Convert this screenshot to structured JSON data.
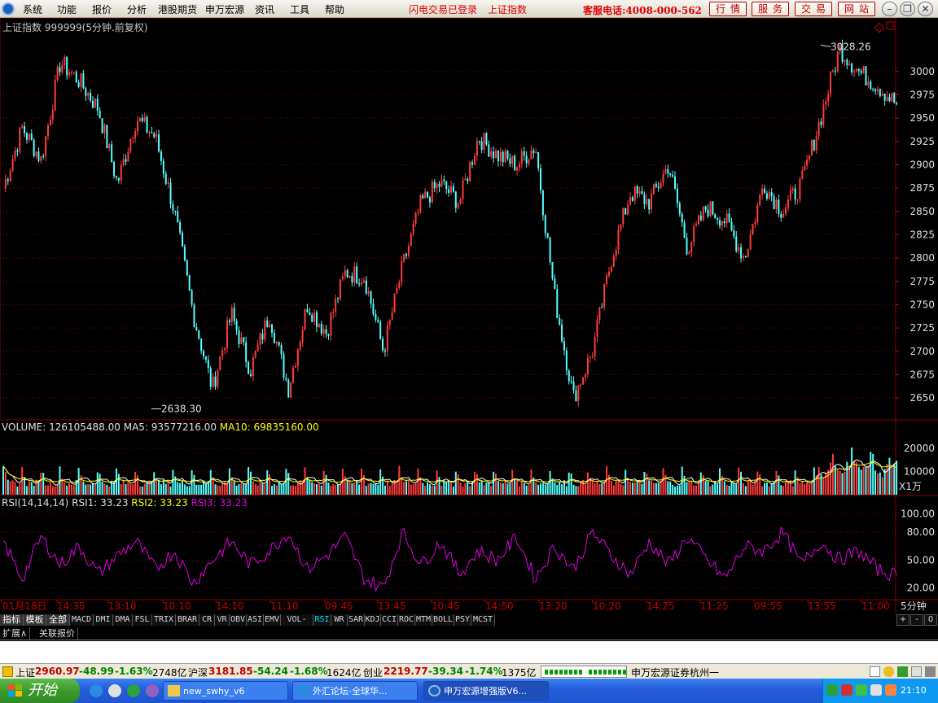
{
  "menu": {
    "items": [
      "系统",
      "功能",
      "报价",
      "分析",
      "港股期货",
      "申万宏源",
      "资讯",
      "工具",
      "帮助"
    ],
    "flash_status": "闪电交易已登录",
    "index_link": "上证指数",
    "hotline": "客服电话:4008-000-562",
    "buttons": [
      "行情",
      "服务",
      "交易",
      "网站"
    ]
  },
  "chart": {
    "main_title": "上证指数 999999(5分钟.前复权)",
    "high_label": "3028.26",
    "low_label": "2638.30",
    "vol_title": {
      "volume": "VOLUME: 126105488.00",
      "ma5": "MA5: 93577216.00",
      "ma10": "MA10: 69835160.00"
    },
    "vol_unit": "X1万",
    "rsi_title": {
      "name": "RSI(14,14,14)",
      "rsi1": "RSI1: 33.23",
      "rsi2": "RSI2: 33.23",
      "rsi3": "RSI3: 33.23"
    },
    "period_label": "5分钟",
    "colors": {
      "up": "#ff3c3c",
      "down": "#54ffff",
      "grid": "#8a0000",
      "ma5": "#ffffff",
      "ma10": "#ffff00",
      "rsi": "#e000e0"
    }
  },
  "chart_data": [
    {
      "type": "line",
      "title": "上证指数 999999(5分钟.前复权)",
      "ylim": [
        2630,
        3040
      ],
      "y_ticks": [
        2650,
        2675,
        2700,
        2725,
        2750,
        2775,
        2800,
        2825,
        2850,
        2875,
        2900,
        2925,
        2950,
        2975,
        3000
      ],
      "annotations": [
        {
          "label": "3028.26",
          "y": 3028.26
        },
        {
          "label": "2638.30",
          "y": 2638.3
        }
      ],
      "series": [
        {
          "values": [
            2875,
            2940,
            2905,
            3010,
            2990,
            2960,
            2880,
            2950,
            2930,
            2850,
            2740,
            2660,
            2740,
            2680,
            2740,
            2660,
            2750,
            2720,
            2785,
            2780,
            2700,
            2790,
            2860,
            2880,
            2860,
            2930,
            2910,
            2900,
            2920,
            2760,
            2650,
            2700,
            2800,
            2870,
            2860,
            2900,
            2810,
            2855,
            2840,
            2800,
            2880,
            2850,
            2880,
            2950,
            3025,
            3000,
            2985,
            2965
          ]
        }
      ]
    },
    {
      "type": "bar",
      "title": "VOLUME",
      "ylim": [
        0,
        25000
      ],
      "y_ticks": [
        10000,
        20000
      ],
      "unit": "X1万",
      "series": [
        {
          "name": "MA5",
          "values": [
            93577216.0
          ]
        },
        {
          "name": "MA10",
          "values": [
            69835160.0
          ]
        }
      ]
    },
    {
      "type": "line",
      "title": "RSI(14,14,14)",
      "ylim": [
        10,
        110
      ],
      "y_ticks": [
        20,
        50,
        80,
        100
      ],
      "series": [
        {
          "name": "RSI3",
          "values": [
            70,
            30,
            75,
            45,
            65,
            35,
            55,
            70,
            40,
            60,
            25,
            50,
            70,
            45,
            60,
            80,
            40,
            55,
            75,
            30,
            20,
            80,
            45,
            70,
            35,
            60,
            50,
            75,
            30,
            65,
            40,
            80,
            55,
            35,
            70,
            45,
            75,
            50,
            30,
            65,
            60,
            80,
            45,
            70,
            50,
            60,
            40,
            33
          ]
        }
      ]
    }
  ],
  "time_axis": {
    "labels": [
      "01月18日",
      "14:35",
      "13:10",
      "10:10",
      "14:10",
      "11:10",
      "09:45",
      "13:45",
      "10:45",
      "14:50",
      "13:20",
      "10:20",
      "14:25",
      "11:25",
      "09:55",
      "13:55",
      "11:00"
    ]
  },
  "indicator_tabs": [
    "指标",
    "模板",
    "全部",
    "MACD",
    "DMI",
    "DMA",
    "FSL",
    "TRIX",
    "BRAR",
    "CR",
    "VR",
    "OBV",
    "ASI",
    "EMV",
    "VOL-TDX",
    "RSI",
    "WR",
    "SAR",
    "KDJ",
    "CCI",
    "ROC",
    "MTM",
    "BOLL",
    "PSY",
    "MCST"
  ],
  "indicator_controls": [
    "+",
    "-",
    "0"
  ],
  "ext_tabs": [
    "扩展∧",
    "关联报价"
  ],
  "status": {
    "sh_label": "上证",
    "sh_price": "2960.97",
    "sh_change": "-48.99",
    "sh_pct": "-1.63%",
    "sh_amount": "2748亿",
    "hs_label": "沪深",
    "hs_price": "3181.85",
    "hs_change": "-54.24",
    "hs_pct": "-1.68%",
    "hs_amount": "1624亿",
    "cy_label": "创业",
    "cy_price": "2219.77",
    "cy_change": "-39.34",
    "cy_pct": "-1.74%",
    "cy_amount": "1375亿",
    "broker": "申万宏源证券杭州一"
  },
  "taskbar": {
    "start_label": "开始",
    "tasks": [
      "new_swhy_v6",
      "外汇论坛-全球华...",
      "申万宏源增强版V6..."
    ],
    "clock": "21:10"
  }
}
